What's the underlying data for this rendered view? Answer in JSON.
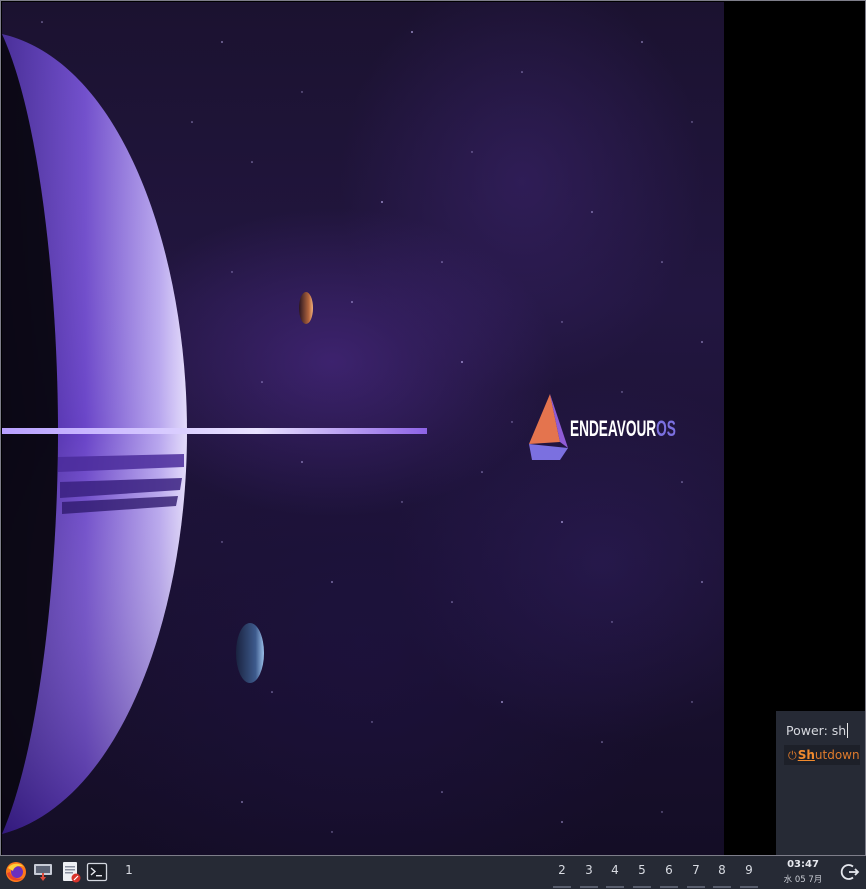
{
  "wallpaper": {
    "logo_main": "ENDEAVOUR",
    "logo_accent": "OS",
    "accent_color": "#7b70e0"
  },
  "power_menu": {
    "prompt_label": "Power:",
    "typed_text": "sh",
    "option_highlight": "Sh",
    "option_rest": "utdown",
    "option_icon": "power-icon",
    "option_color": "#e07b2c"
  },
  "taskbar": {
    "launchers": [
      "firefox-icon",
      "software-update-icon",
      "text-editor-icon",
      "terminal-icon"
    ],
    "active_workspace": "1",
    "workspaces": [
      "2",
      "3",
      "4",
      "5",
      "6",
      "7",
      "8",
      "9"
    ],
    "clock_time": "03:47",
    "clock_date": "水 05 7月",
    "power_button_icon": "power-exit-icon"
  }
}
